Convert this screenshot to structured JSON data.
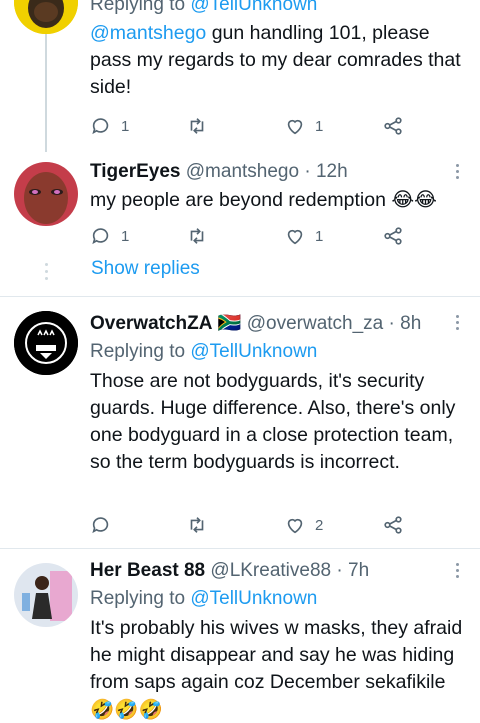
{
  "tweet1": {
    "replying_prefix": "Replying to ",
    "replying_handle": "@TellUnknown",
    "mention": "@mantshego",
    "text": " gun handling 101, please pass my regards to my dear comrades that side!",
    "reply_count": "1",
    "like_count": "1",
    "reply_icon": "reply-icon",
    "retweet_icon": "retweet-icon",
    "like_icon": "heart-icon",
    "share_icon": "share-icon"
  },
  "tweet2": {
    "name": "TigerEyes",
    "handle": "@mantshego",
    "separator": " · ",
    "time": "12h",
    "text": "my people are beyond redemption ",
    "emoji": "😂😂",
    "reply_count": "1",
    "like_count": "1"
  },
  "show_replies": "Show replies",
  "tweet3": {
    "name": "OverwatchZA",
    "flag": "🇿🇦",
    "handle": "@overwatch_za",
    "separator": " · ",
    "time": "8h",
    "replying_prefix": "Replying to ",
    "replying_handle": "@TellUnknown",
    "text": "Those are not bodyguards, it's security guards. Huge difference. Also, there's only one bodyguard in a close protection team, so the term bodyguards is incorrect.",
    "like_count": "2"
  },
  "tweet4": {
    "name": "Her Beast 88",
    "handle": "@LKreative88",
    "separator": " · ",
    "time": "7h",
    "replying_prefix": "Replying to ",
    "replying_handle": "@TellUnknown",
    "text": "It's probably his wives w masks, they afraid he might disappear and say he was hiding from saps again coz December sekafikile ",
    "emoji": "🤣🤣🤣"
  },
  "colors": {
    "link": "#1d9bf0",
    "secondary_text": "#536471",
    "divider": "#e1e8ed"
  }
}
